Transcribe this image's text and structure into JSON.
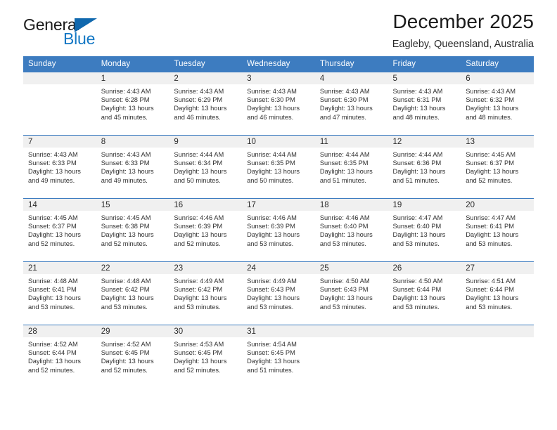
{
  "brand": {
    "name_part1": "General",
    "name_part2": "Blue",
    "triangle_color": "#1068ae",
    "blue_color": "#1277c4"
  },
  "header": {
    "title": "December 2025",
    "subtitle": "Eagleby, Queensland, Australia"
  },
  "theme": {
    "header_blue": "#3d7cc0",
    "daynum_band": "#f0f0f0",
    "text": "#2b2b2b"
  },
  "weekday_headers": [
    "Sunday",
    "Monday",
    "Tuesday",
    "Wednesday",
    "Thursday",
    "Friday",
    "Saturday"
  ],
  "weeks": [
    {
      "days": [
        {
          "num": "",
          "sunrise": "",
          "sunset": "",
          "daylight_line1": "",
          "daylight_line2": "",
          "empty": true
        },
        {
          "num": "1",
          "sunrise": "Sunrise: 4:43 AM",
          "sunset": "Sunset: 6:28 PM",
          "daylight_line1": "Daylight: 13 hours",
          "daylight_line2": "and 45 minutes."
        },
        {
          "num": "2",
          "sunrise": "Sunrise: 4:43 AM",
          "sunset": "Sunset: 6:29 PM",
          "daylight_line1": "Daylight: 13 hours",
          "daylight_line2": "and 46 minutes."
        },
        {
          "num": "3",
          "sunrise": "Sunrise: 4:43 AM",
          "sunset": "Sunset: 6:30 PM",
          "daylight_line1": "Daylight: 13 hours",
          "daylight_line2": "and 46 minutes."
        },
        {
          "num": "4",
          "sunrise": "Sunrise: 4:43 AM",
          "sunset": "Sunset: 6:30 PM",
          "daylight_line1": "Daylight: 13 hours",
          "daylight_line2": "and 47 minutes."
        },
        {
          "num": "5",
          "sunrise": "Sunrise: 4:43 AM",
          "sunset": "Sunset: 6:31 PM",
          "daylight_line1": "Daylight: 13 hours",
          "daylight_line2": "and 48 minutes."
        },
        {
          "num": "6",
          "sunrise": "Sunrise: 4:43 AM",
          "sunset": "Sunset: 6:32 PM",
          "daylight_line1": "Daylight: 13 hours",
          "daylight_line2": "and 48 minutes."
        }
      ]
    },
    {
      "days": [
        {
          "num": "7",
          "sunrise": "Sunrise: 4:43 AM",
          "sunset": "Sunset: 6:33 PM",
          "daylight_line1": "Daylight: 13 hours",
          "daylight_line2": "and 49 minutes."
        },
        {
          "num": "8",
          "sunrise": "Sunrise: 4:43 AM",
          "sunset": "Sunset: 6:33 PM",
          "daylight_line1": "Daylight: 13 hours",
          "daylight_line2": "and 49 minutes."
        },
        {
          "num": "9",
          "sunrise": "Sunrise: 4:44 AM",
          "sunset": "Sunset: 6:34 PM",
          "daylight_line1": "Daylight: 13 hours",
          "daylight_line2": "and 50 minutes."
        },
        {
          "num": "10",
          "sunrise": "Sunrise: 4:44 AM",
          "sunset": "Sunset: 6:35 PM",
          "daylight_line1": "Daylight: 13 hours",
          "daylight_line2": "and 50 minutes."
        },
        {
          "num": "11",
          "sunrise": "Sunrise: 4:44 AM",
          "sunset": "Sunset: 6:35 PM",
          "daylight_line1": "Daylight: 13 hours",
          "daylight_line2": "and 51 minutes."
        },
        {
          "num": "12",
          "sunrise": "Sunrise: 4:44 AM",
          "sunset": "Sunset: 6:36 PM",
          "daylight_line1": "Daylight: 13 hours",
          "daylight_line2": "and 51 minutes."
        },
        {
          "num": "13",
          "sunrise": "Sunrise: 4:45 AM",
          "sunset": "Sunset: 6:37 PM",
          "daylight_line1": "Daylight: 13 hours",
          "daylight_line2": "and 52 minutes."
        }
      ]
    },
    {
      "days": [
        {
          "num": "14",
          "sunrise": "Sunrise: 4:45 AM",
          "sunset": "Sunset: 6:37 PM",
          "daylight_line1": "Daylight: 13 hours",
          "daylight_line2": "and 52 minutes."
        },
        {
          "num": "15",
          "sunrise": "Sunrise: 4:45 AM",
          "sunset": "Sunset: 6:38 PM",
          "daylight_line1": "Daylight: 13 hours",
          "daylight_line2": "and 52 minutes."
        },
        {
          "num": "16",
          "sunrise": "Sunrise: 4:46 AM",
          "sunset": "Sunset: 6:39 PM",
          "daylight_line1": "Daylight: 13 hours",
          "daylight_line2": "and 52 minutes."
        },
        {
          "num": "17",
          "sunrise": "Sunrise: 4:46 AM",
          "sunset": "Sunset: 6:39 PM",
          "daylight_line1": "Daylight: 13 hours",
          "daylight_line2": "and 53 minutes."
        },
        {
          "num": "18",
          "sunrise": "Sunrise: 4:46 AM",
          "sunset": "Sunset: 6:40 PM",
          "daylight_line1": "Daylight: 13 hours",
          "daylight_line2": "and 53 minutes."
        },
        {
          "num": "19",
          "sunrise": "Sunrise: 4:47 AM",
          "sunset": "Sunset: 6:40 PM",
          "daylight_line1": "Daylight: 13 hours",
          "daylight_line2": "and 53 minutes."
        },
        {
          "num": "20",
          "sunrise": "Sunrise: 4:47 AM",
          "sunset": "Sunset: 6:41 PM",
          "daylight_line1": "Daylight: 13 hours",
          "daylight_line2": "and 53 minutes."
        }
      ]
    },
    {
      "days": [
        {
          "num": "21",
          "sunrise": "Sunrise: 4:48 AM",
          "sunset": "Sunset: 6:41 PM",
          "daylight_line1": "Daylight: 13 hours",
          "daylight_line2": "and 53 minutes."
        },
        {
          "num": "22",
          "sunrise": "Sunrise: 4:48 AM",
          "sunset": "Sunset: 6:42 PM",
          "daylight_line1": "Daylight: 13 hours",
          "daylight_line2": "and 53 minutes."
        },
        {
          "num": "23",
          "sunrise": "Sunrise: 4:49 AM",
          "sunset": "Sunset: 6:42 PM",
          "daylight_line1": "Daylight: 13 hours",
          "daylight_line2": "and 53 minutes."
        },
        {
          "num": "24",
          "sunrise": "Sunrise: 4:49 AM",
          "sunset": "Sunset: 6:43 PM",
          "daylight_line1": "Daylight: 13 hours",
          "daylight_line2": "and 53 minutes."
        },
        {
          "num": "25",
          "sunrise": "Sunrise: 4:50 AM",
          "sunset": "Sunset: 6:43 PM",
          "daylight_line1": "Daylight: 13 hours",
          "daylight_line2": "and 53 minutes."
        },
        {
          "num": "26",
          "sunrise": "Sunrise: 4:50 AM",
          "sunset": "Sunset: 6:44 PM",
          "daylight_line1": "Daylight: 13 hours",
          "daylight_line2": "and 53 minutes."
        },
        {
          "num": "27",
          "sunrise": "Sunrise: 4:51 AM",
          "sunset": "Sunset: 6:44 PM",
          "daylight_line1": "Daylight: 13 hours",
          "daylight_line2": "and 53 minutes."
        }
      ]
    },
    {
      "days": [
        {
          "num": "28",
          "sunrise": "Sunrise: 4:52 AM",
          "sunset": "Sunset: 6:44 PM",
          "daylight_line1": "Daylight: 13 hours",
          "daylight_line2": "and 52 minutes."
        },
        {
          "num": "29",
          "sunrise": "Sunrise: 4:52 AM",
          "sunset": "Sunset: 6:45 PM",
          "daylight_line1": "Daylight: 13 hours",
          "daylight_line2": "and 52 minutes."
        },
        {
          "num": "30",
          "sunrise": "Sunrise: 4:53 AM",
          "sunset": "Sunset: 6:45 PM",
          "daylight_line1": "Daylight: 13 hours",
          "daylight_line2": "and 52 minutes."
        },
        {
          "num": "31",
          "sunrise": "Sunrise: 4:54 AM",
          "sunset": "Sunset: 6:45 PM",
          "daylight_line1": "Daylight: 13 hours",
          "daylight_line2": "and 51 minutes."
        },
        {
          "num": "",
          "sunrise": "",
          "sunset": "",
          "daylight_line1": "",
          "daylight_line2": "",
          "empty": true
        },
        {
          "num": "",
          "sunrise": "",
          "sunset": "",
          "daylight_line1": "",
          "daylight_line2": "",
          "empty": true
        },
        {
          "num": "",
          "sunrise": "",
          "sunset": "",
          "daylight_line1": "",
          "daylight_line2": "",
          "empty": true
        }
      ]
    }
  ]
}
